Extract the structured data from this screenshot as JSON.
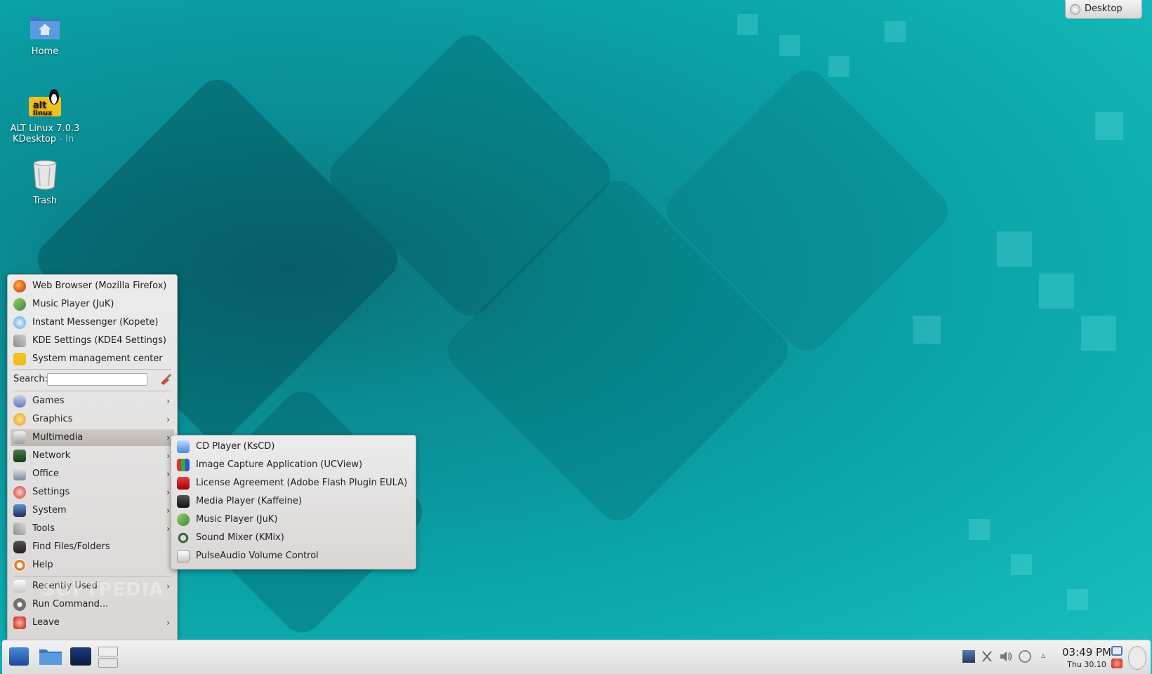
{
  "desktop": {
    "icons": [
      {
        "label": "Home"
      },
      {
        "label_line1": "ALT Linux 7.0.3",
        "label_line2": "KDesktop",
        "suffix": "- In"
      },
      {
        "label": "Trash"
      }
    ],
    "toolbox_label": "Desktop"
  },
  "menu": {
    "favorites": [
      {
        "label": "Web Browser (Mozilla Firefox)",
        "icon": "firefox-icon"
      },
      {
        "label": "Music Player (JuK)",
        "icon": "juk-icon"
      },
      {
        "label": "Instant Messenger (Kopete)",
        "icon": "kopete-icon"
      },
      {
        "label": "KDE Settings (KDE4 Settings)",
        "icon": "settings-tools-icon"
      },
      {
        "label": "System management center",
        "icon": "altlinux-icon"
      }
    ],
    "search_label": "Search:",
    "categories": [
      {
        "label": "Games"
      },
      {
        "label": "Graphics"
      },
      {
        "label": "Multimedia"
      },
      {
        "label": "Network"
      },
      {
        "label": "Office"
      },
      {
        "label": "Settings"
      },
      {
        "label": "System"
      },
      {
        "label": "Tools"
      },
      {
        "label": "Find Files/Folders"
      },
      {
        "label": "Help"
      }
    ],
    "bottom": [
      {
        "label": "Recently Used"
      },
      {
        "label": "Run Command..."
      },
      {
        "label": "Leave"
      }
    ],
    "arrow": "›"
  },
  "submenu": {
    "items": [
      {
        "label": "CD Player (KsCD)"
      },
      {
        "label": "Image Capture Application (UCView)"
      },
      {
        "label": "License Agreement (Adobe Flash Plugin EULA)"
      },
      {
        "label": "Media Player (Kaffeine)"
      },
      {
        "label": "Music Player (JuK)"
      },
      {
        "label": "Sound Mixer (KMix)"
      },
      {
        "label": "PulseAudio Volume Control"
      }
    ]
  },
  "watermark": "SOFTPEDIA",
  "taskbar": {
    "time": "03:49 PM",
    "date": "Thu 30.10"
  },
  "colors": {
    "accent": "#0aa3a8",
    "menu_bg": "#e4e1df"
  }
}
